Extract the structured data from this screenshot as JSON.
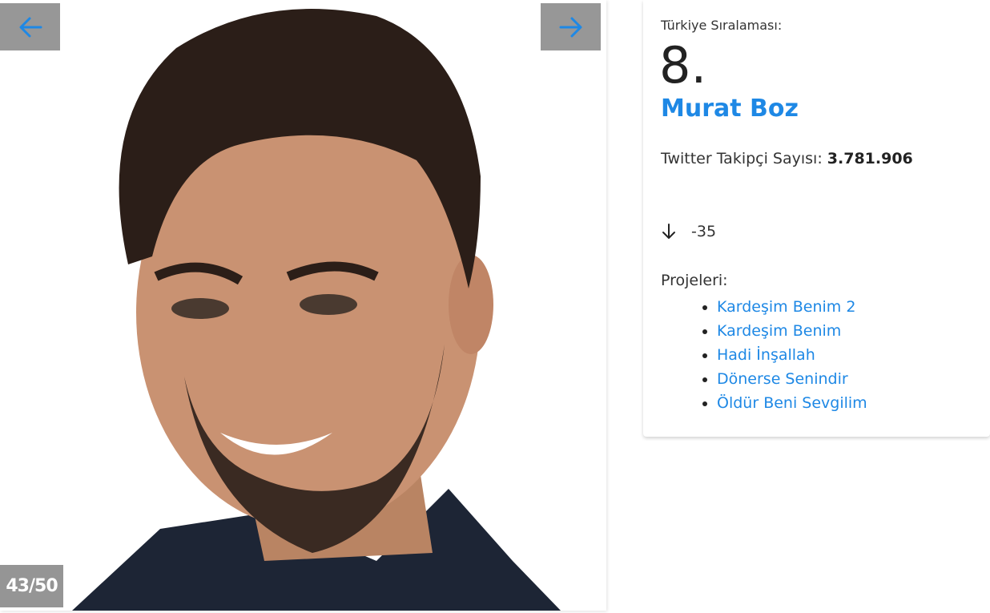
{
  "gallery": {
    "counter": "43/50",
    "prev_icon": "arrow-left-icon",
    "next_icon": "arrow-right-icon",
    "photo": "portrait-photo"
  },
  "profile": {
    "rank_label": "Türkiye Sıralaması:",
    "rank_value": "8.",
    "name": "Murat Boz",
    "followers_label": "Twitter Takipçi Sayısı:",
    "followers_value": "3.781.906",
    "change_icon": "arrow-down-icon",
    "change_value": "-35",
    "projects_label": "Projeleri:",
    "projects": [
      "Kardeşim Benim 2",
      "Kardeşim Benim",
      "Hadi İnşallah",
      "Dönerse Senindir",
      "Öldür Beni Sevgilim"
    ]
  },
  "colors": {
    "accent": "#1e88e5",
    "nav_bg": "#8c8c8c"
  }
}
